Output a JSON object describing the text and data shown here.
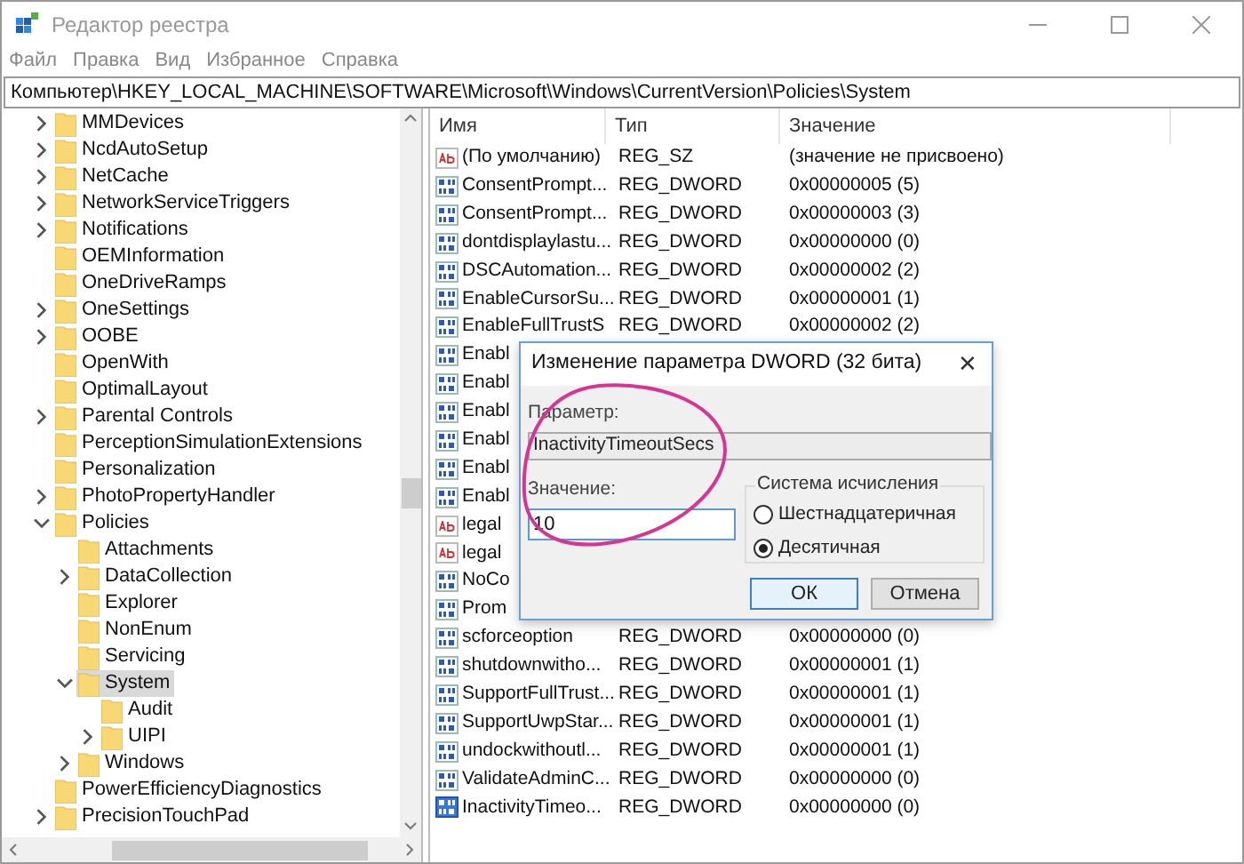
{
  "window": {
    "title": "Редактор реестра"
  },
  "menu": [
    "Файл",
    "Правка",
    "Вид",
    "Избранное",
    "Справка"
  ],
  "address": "Компьютер\\HKEY_LOCAL_MACHINE\\SOFTWARE\\Microsoft\\Windows\\CurrentVersion\\Policies\\System",
  "tree": [
    {
      "label": "MMDevices",
      "expandable": true,
      "expanded": false,
      "selected": false
    },
    {
      "label": "NcdAutoSetup",
      "expandable": true,
      "expanded": false,
      "selected": false
    },
    {
      "label": "NetCache",
      "expandable": true,
      "expanded": false,
      "selected": false
    },
    {
      "label": "NetworkServiceTriggers",
      "expandable": true,
      "expanded": false,
      "selected": false
    },
    {
      "label": "Notifications",
      "expandable": true,
      "expanded": false,
      "selected": false
    },
    {
      "label": "OEMInformation",
      "expandable": false,
      "selected": false
    },
    {
      "label": "OneDriveRamps",
      "expandable": false,
      "selected": false
    },
    {
      "label": "OneSettings",
      "expandable": true,
      "expanded": false,
      "selected": false
    },
    {
      "label": "OOBE",
      "expandable": true,
      "expanded": false,
      "selected": false
    },
    {
      "label": "OpenWith",
      "expandable": false,
      "selected": false
    },
    {
      "label": "OptimalLayout",
      "expandable": false,
      "selected": false
    },
    {
      "label": "Parental Controls",
      "expandable": true,
      "expanded": false,
      "selected": false
    },
    {
      "label": "PerceptionSimulationExtensions",
      "expandable": false,
      "selected": false
    },
    {
      "label": "Personalization",
      "expandable": false,
      "selected": false
    },
    {
      "label": "PhotoPropertyHandler",
      "expandable": true,
      "expanded": false,
      "selected": false
    },
    {
      "label": "Policies",
      "expandable": true,
      "expanded": true,
      "selected": false,
      "children": [
        {
          "label": "Attachments",
          "expandable": false,
          "selected": false
        },
        {
          "label": "DataCollection",
          "expandable": true,
          "expanded": false,
          "selected": false
        },
        {
          "label": "Explorer",
          "expandable": false,
          "selected": false
        },
        {
          "label": "NonEnum",
          "expandable": false,
          "selected": false
        },
        {
          "label": "Servicing",
          "expandable": false,
          "selected": false
        },
        {
          "label": "System",
          "expandable": true,
          "expanded": true,
          "selected": true,
          "children": [
            {
              "label": "Audit",
              "expandable": false,
              "selected": false
            },
            {
              "label": "UIPI",
              "expandable": true,
              "expanded": false,
              "selected": false
            }
          ]
        },
        {
          "label": "Windows",
          "expandable": true,
          "expanded": false,
          "selected": false
        }
      ]
    },
    {
      "label": "PowerEfficiencyDiagnostics",
      "expandable": false,
      "selected": false
    },
    {
      "label": "PrecisionTouchPad",
      "expandable": true,
      "expanded": false,
      "selected": false
    }
  ],
  "table": {
    "columns": [
      "Имя",
      "Тип",
      "Значение"
    ],
    "rows": [
      {
        "kind": "string",
        "name": "(По умолчанию)",
        "type": "REG_SZ",
        "value": "(значение не присвоено)",
        "selected": false
      },
      {
        "kind": "binary",
        "name": "ConsentPrompt...",
        "type": "REG_DWORD",
        "value": "0x00000005 (5)",
        "selected": false
      },
      {
        "kind": "binary",
        "name": "ConsentPrompt...",
        "type": "REG_DWORD",
        "value": "0x00000003 (3)",
        "selected": false
      },
      {
        "kind": "binary",
        "name": "dontdisplaylastu...",
        "type": "REG_DWORD",
        "value": "0x00000000 (0)",
        "selected": false
      },
      {
        "kind": "binary",
        "name": "DSCAutomation...",
        "type": "REG_DWORD",
        "value": "0x00000002 (2)",
        "selected": false
      },
      {
        "kind": "binary",
        "name": "EnableCursorSu...",
        "type": "REG_DWORD",
        "value": "0x00000001 (1)",
        "selected": false
      },
      {
        "kind": "binary",
        "name": "EnableFullTrustS",
        "type": "REG_DWORD",
        "value": "0x00000002 (2)",
        "selected": false
      },
      {
        "kind": "binary",
        "name": "Enabl",
        "selected": false
      },
      {
        "kind": "binary",
        "name": "Enabl",
        "selected": false
      },
      {
        "kind": "binary",
        "name": "Enabl",
        "selected": false
      },
      {
        "kind": "binary",
        "name": "Enabl",
        "selected": false
      },
      {
        "kind": "binary",
        "name": "Enabl",
        "selected": false
      },
      {
        "kind": "binary",
        "name": "Enabl",
        "selected": false
      },
      {
        "kind": "string",
        "name": "legal",
        "selected": false
      },
      {
        "kind": "string",
        "name": "legal",
        "selected": false
      },
      {
        "kind": "binary",
        "name": "NoCo",
        "selected": false
      },
      {
        "kind": "binary",
        "name": "Prom",
        "selected": false
      },
      {
        "kind": "binary",
        "name": "scforceoption",
        "type": "REG_DWORD",
        "value": "0x00000000 (0)",
        "selected": false
      },
      {
        "kind": "binary",
        "name": "shutdownwitho...",
        "type": "REG_DWORD",
        "value": "0x00000001 (1)",
        "selected": false
      },
      {
        "kind": "binary",
        "name": "SupportFullTrust...",
        "type": "REG_DWORD",
        "value": "0x00000001 (1)",
        "selected": false
      },
      {
        "kind": "binary",
        "name": "SupportUwpStar...",
        "type": "REG_DWORD",
        "value": "0x00000001 (1)",
        "selected": false
      },
      {
        "kind": "binary",
        "name": "undockwithoutl...",
        "type": "REG_DWORD",
        "value": "0x00000001 (1)",
        "selected": false
      },
      {
        "kind": "binary",
        "name": "ValidateAdminC...",
        "type": "REG_DWORD",
        "value": "0x00000000 (0)",
        "selected": false
      },
      {
        "kind": "binary",
        "name": "InactivityTimeo...",
        "type": "REG_DWORD",
        "value": "0x00000000 (0)",
        "selected": true
      }
    ]
  },
  "dialog": {
    "title": "Изменение параметра DWORD (32 бита)",
    "close": "✕",
    "param_label": "Параметр:",
    "param_value": "InactivityTimeoutSecs",
    "value_label": "Значение:",
    "value": "10",
    "base_group": "Система исчисления",
    "bases": [
      {
        "label": "Шестнадцатеричная",
        "selected": false
      },
      {
        "label": "Десятичная",
        "selected": true
      }
    ],
    "buttons": [
      {
        "label": "ОК",
        "default": true
      },
      {
        "label": "Отмена",
        "default": false
      }
    ]
  }
}
